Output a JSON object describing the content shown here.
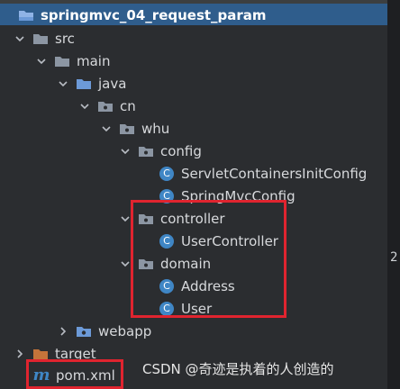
{
  "project": {
    "name": "springmvc_04_request_param"
  },
  "tree": {
    "src": "src",
    "main": "main",
    "java": "java",
    "cn": "cn",
    "whu": "whu",
    "config": "config",
    "servlet_config": "ServletContainersInitConfig",
    "springmvc_config": "SpringMvcConfig",
    "controller": "controller",
    "user_controller": "UserController",
    "domain": "domain",
    "address": "Address",
    "user": "User",
    "webapp": "webapp",
    "target": "target",
    "pom": "pom.xml"
  },
  "class_icon_letter": "C",
  "maven_icon_letter": "m",
  "watermark": "CSDN @奇迹是执着的人创造的",
  "gutter": {
    "line_number": "2"
  },
  "colors": {
    "selection": "#2f5d8c",
    "folder_blue": "#6c9ad8",
    "folder_gray": "#8c96a3",
    "folder_orange": "#c5743a",
    "class_icon": "#3f86c5",
    "highlight_box": "#e0242f"
  }
}
